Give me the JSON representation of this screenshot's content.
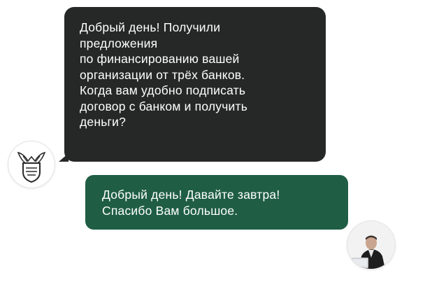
{
  "chat": {
    "incoming": {
      "lines": [
        "Добрый день! Получили",
        "предложения",
        "по финансированию вашей",
        "организации от трёх банков.",
        "Когда вам удобно подписать",
        "договор с банком и получить",
        "деньги?"
      ],
      "color": "#262828",
      "avatar_icon": "bank-logo-icon"
    },
    "outgoing": {
      "lines": [
        "Добрый день! Давайте завтра!",
        "Спасибо Вам большое."
      ],
      "color": "#1f5e44",
      "avatar_icon": "user-photo-icon"
    }
  }
}
